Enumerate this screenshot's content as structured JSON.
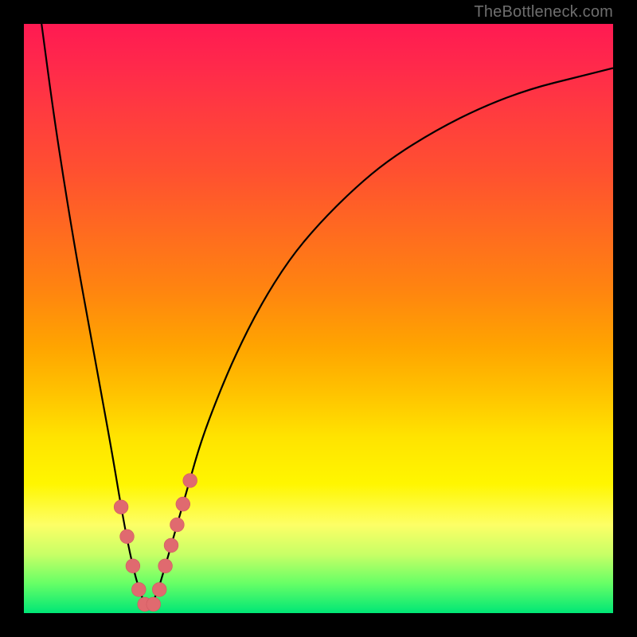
{
  "watermark": "TheBottleneck.com",
  "colors": {
    "frame": "#000000",
    "curve": "#000000",
    "marker_fill": "#e06a6f",
    "marker_stroke": "#d05a60",
    "gradient_top": "#ff1a52",
    "gradient_bottom": "#00e676"
  },
  "chart_data": {
    "type": "line",
    "title": "",
    "xlabel": "",
    "ylabel": "",
    "xlim": [
      0,
      100
    ],
    "ylim": [
      0,
      100
    ],
    "annotations": [],
    "note": "Y values read as percentage of vertical axis (top=100, bottom=0). V-shaped bottleneck curve with minimum near x≈21, sharp left flank, asymptotic right flank.",
    "series": [
      {
        "name": "curve",
        "stroke": "#000000",
        "x": [
          3,
          5,
          7,
          9,
          11,
          13,
          15,
          16.5,
          18,
          19.5,
          21,
          22.5,
          24,
          26,
          28,
          30,
          33,
          36,
          40,
          45,
          50,
          56,
          62,
          70,
          78,
          86,
          94,
          100
        ],
        "y": [
          100,
          85,
          72,
          60,
          49,
          38,
          27,
          18,
          10,
          4,
          0.5,
          3,
          8,
          15,
          22,
          29,
          37,
          44,
          52,
          60,
          66,
          72,
          77,
          82,
          86,
          89,
          91,
          92.5
        ]
      }
    ],
    "markers": {
      "name": "highlight-points",
      "fill": "#e06a6f",
      "radius_pct": 1.2,
      "x": [
        16.5,
        17.5,
        18.5,
        19.5,
        20.5,
        22,
        23,
        24,
        25,
        26,
        27,
        28.2
      ],
      "y": [
        18,
        13,
        8,
        4,
        1.5,
        1.5,
        4,
        8,
        11.5,
        15,
        18.5,
        22.5
      ]
    }
  }
}
